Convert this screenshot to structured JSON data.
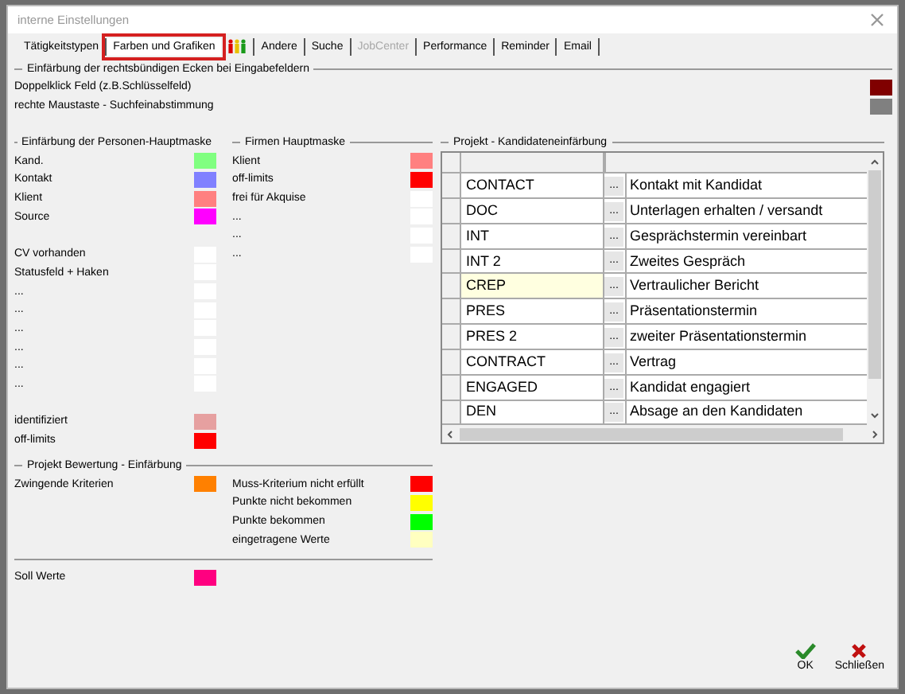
{
  "window": {
    "title": "interne Einstellungen"
  },
  "tabs": [
    {
      "kind": "text",
      "label": "Tätigkeitstypen",
      "selected": false,
      "disabled": false,
      "highlighted": false
    },
    {
      "kind": "text",
      "label": "Farben und Grafiken",
      "selected": true,
      "disabled": false,
      "highlighted": true
    },
    {
      "kind": "icon",
      "selected": false,
      "disabled": false,
      "highlighted": false
    },
    {
      "kind": "text",
      "label": "Andere",
      "selected": false,
      "disabled": false,
      "highlighted": false
    },
    {
      "kind": "text",
      "label": "Suche",
      "selected": false,
      "disabled": false,
      "highlighted": false
    },
    {
      "kind": "text",
      "label": "JobCenter",
      "selected": false,
      "disabled": true,
      "highlighted": false
    },
    {
      "kind": "text",
      "label": "Performance",
      "selected": false,
      "disabled": false,
      "highlighted": false
    },
    {
      "kind": "text",
      "label": "Reminder",
      "selected": false,
      "disabled": false,
      "highlighted": false
    },
    {
      "kind": "text",
      "label": "Email",
      "selected": false,
      "disabled": false,
      "highlighted": false
    }
  ],
  "corner_section": {
    "title": "Einfärbung der rechtsbündigen Ecken bei Eingabefeldern",
    "rows": [
      {
        "label": "Doppelklick Feld (z.B.Schlüsselfeld)",
        "color": "#800000"
      },
      {
        "label": "rechte Maustaste - Suchfeinabstimmung",
        "color": "#808080"
      }
    ]
  },
  "person_section": {
    "title": "Einfärbung der Personen-Hauptmaske",
    "groups": [
      [
        {
          "label": "Kand.",
          "color": "#80ff80"
        },
        {
          "label": "Kontakt",
          "color": "#8080ff"
        },
        {
          "label": "Klient",
          "color": "#ff8080"
        },
        {
          "label": "Source",
          "color": "#ff00ff"
        }
      ],
      [
        {
          "label": "CV vorhanden",
          "color": "#ffffff"
        },
        {
          "label": "Statusfeld + Haken",
          "color": "#ffffff"
        },
        {
          "label": "...",
          "color": "#ffffff"
        },
        {
          "label": "...",
          "color": "#ffffff"
        },
        {
          "label": "...",
          "color": "#ffffff"
        },
        {
          "label": "...",
          "color": "#ffffff"
        },
        {
          "label": "...",
          "color": "#ffffff"
        },
        {
          "label": "...",
          "color": "#ffffff"
        }
      ],
      [
        {
          "label": "identifiziert",
          "color": "#e6a0a0"
        },
        {
          "label": "off-limits",
          "color": "#ff0000"
        }
      ]
    ]
  },
  "company_section": {
    "title": "Firmen Hauptmaske",
    "rows": [
      {
        "label": "Klient",
        "color": "#ff8080"
      },
      {
        "label": "off-limits",
        "color": "#ff0000"
      },
      {
        "label": "frei für Akquise",
        "color": "#ffffff"
      },
      {
        "label": "...",
        "color": "#ffffff"
      },
      {
        "label": "...",
        "color": "#ffffff"
      },
      {
        "label": "...",
        "color": "#ffffff"
      }
    ]
  },
  "rating_section": {
    "title": "Projekt Bewertung - Einfärbung",
    "left": [
      {
        "label": "Zwingende Kriterien",
        "color": "#ff8000"
      }
    ],
    "right": [
      {
        "label": "Muss-Kriterium nicht erfüllt",
        "color": "#ff0000"
      },
      {
        "label": "Punkte nicht bekommen",
        "color": "#ffff00"
      },
      {
        "label": "Punkte bekommen",
        "color": "#00ff00"
      },
      {
        "label": "eingetragene Werte",
        "color": "#ffffc0"
      }
    ]
  },
  "target_values": {
    "label": "Soll Werte",
    "color": "#ff0080"
  },
  "candidate_grid": {
    "title": "Projekt - Kandidateneinfärbung",
    "rows": [
      {
        "code": "CONTACT",
        "picker": "...",
        "description": "Kontakt mit Kandidat",
        "selected": false
      },
      {
        "code": "DOC",
        "picker": "...",
        "description": "Unterlagen erhalten / versandt",
        "selected": false
      },
      {
        "code": "INT",
        "picker": "...",
        "description": "Gesprächstermin vereinbart",
        "selected": false
      },
      {
        "code": "INT 2",
        "picker": "...",
        "description": "Zweites Gespräch",
        "selected": false
      },
      {
        "code": "CREP",
        "picker": "...",
        "description": "Vertraulicher Bericht",
        "selected": true
      },
      {
        "code": "PRES",
        "picker": "...",
        "description": "Präsentationstermin",
        "selected": false
      },
      {
        "code": "PRES 2",
        "picker": "...",
        "description": "zweiter Präsentationstermin",
        "selected": false
      },
      {
        "code": "CONTRACT",
        "picker": "...",
        "description": "Vertrag",
        "selected": false
      },
      {
        "code": "ENGAGED",
        "picker": "...",
        "description": "Kandidat engagiert",
        "selected": false
      },
      {
        "code": "DEN",
        "picker": "...",
        "description": "Absage an den Kandidaten",
        "selected": false
      }
    ]
  },
  "buttons": [
    {
      "kind": "ok",
      "label": "OK"
    },
    {
      "kind": "close",
      "label": "Schließen"
    }
  ]
}
